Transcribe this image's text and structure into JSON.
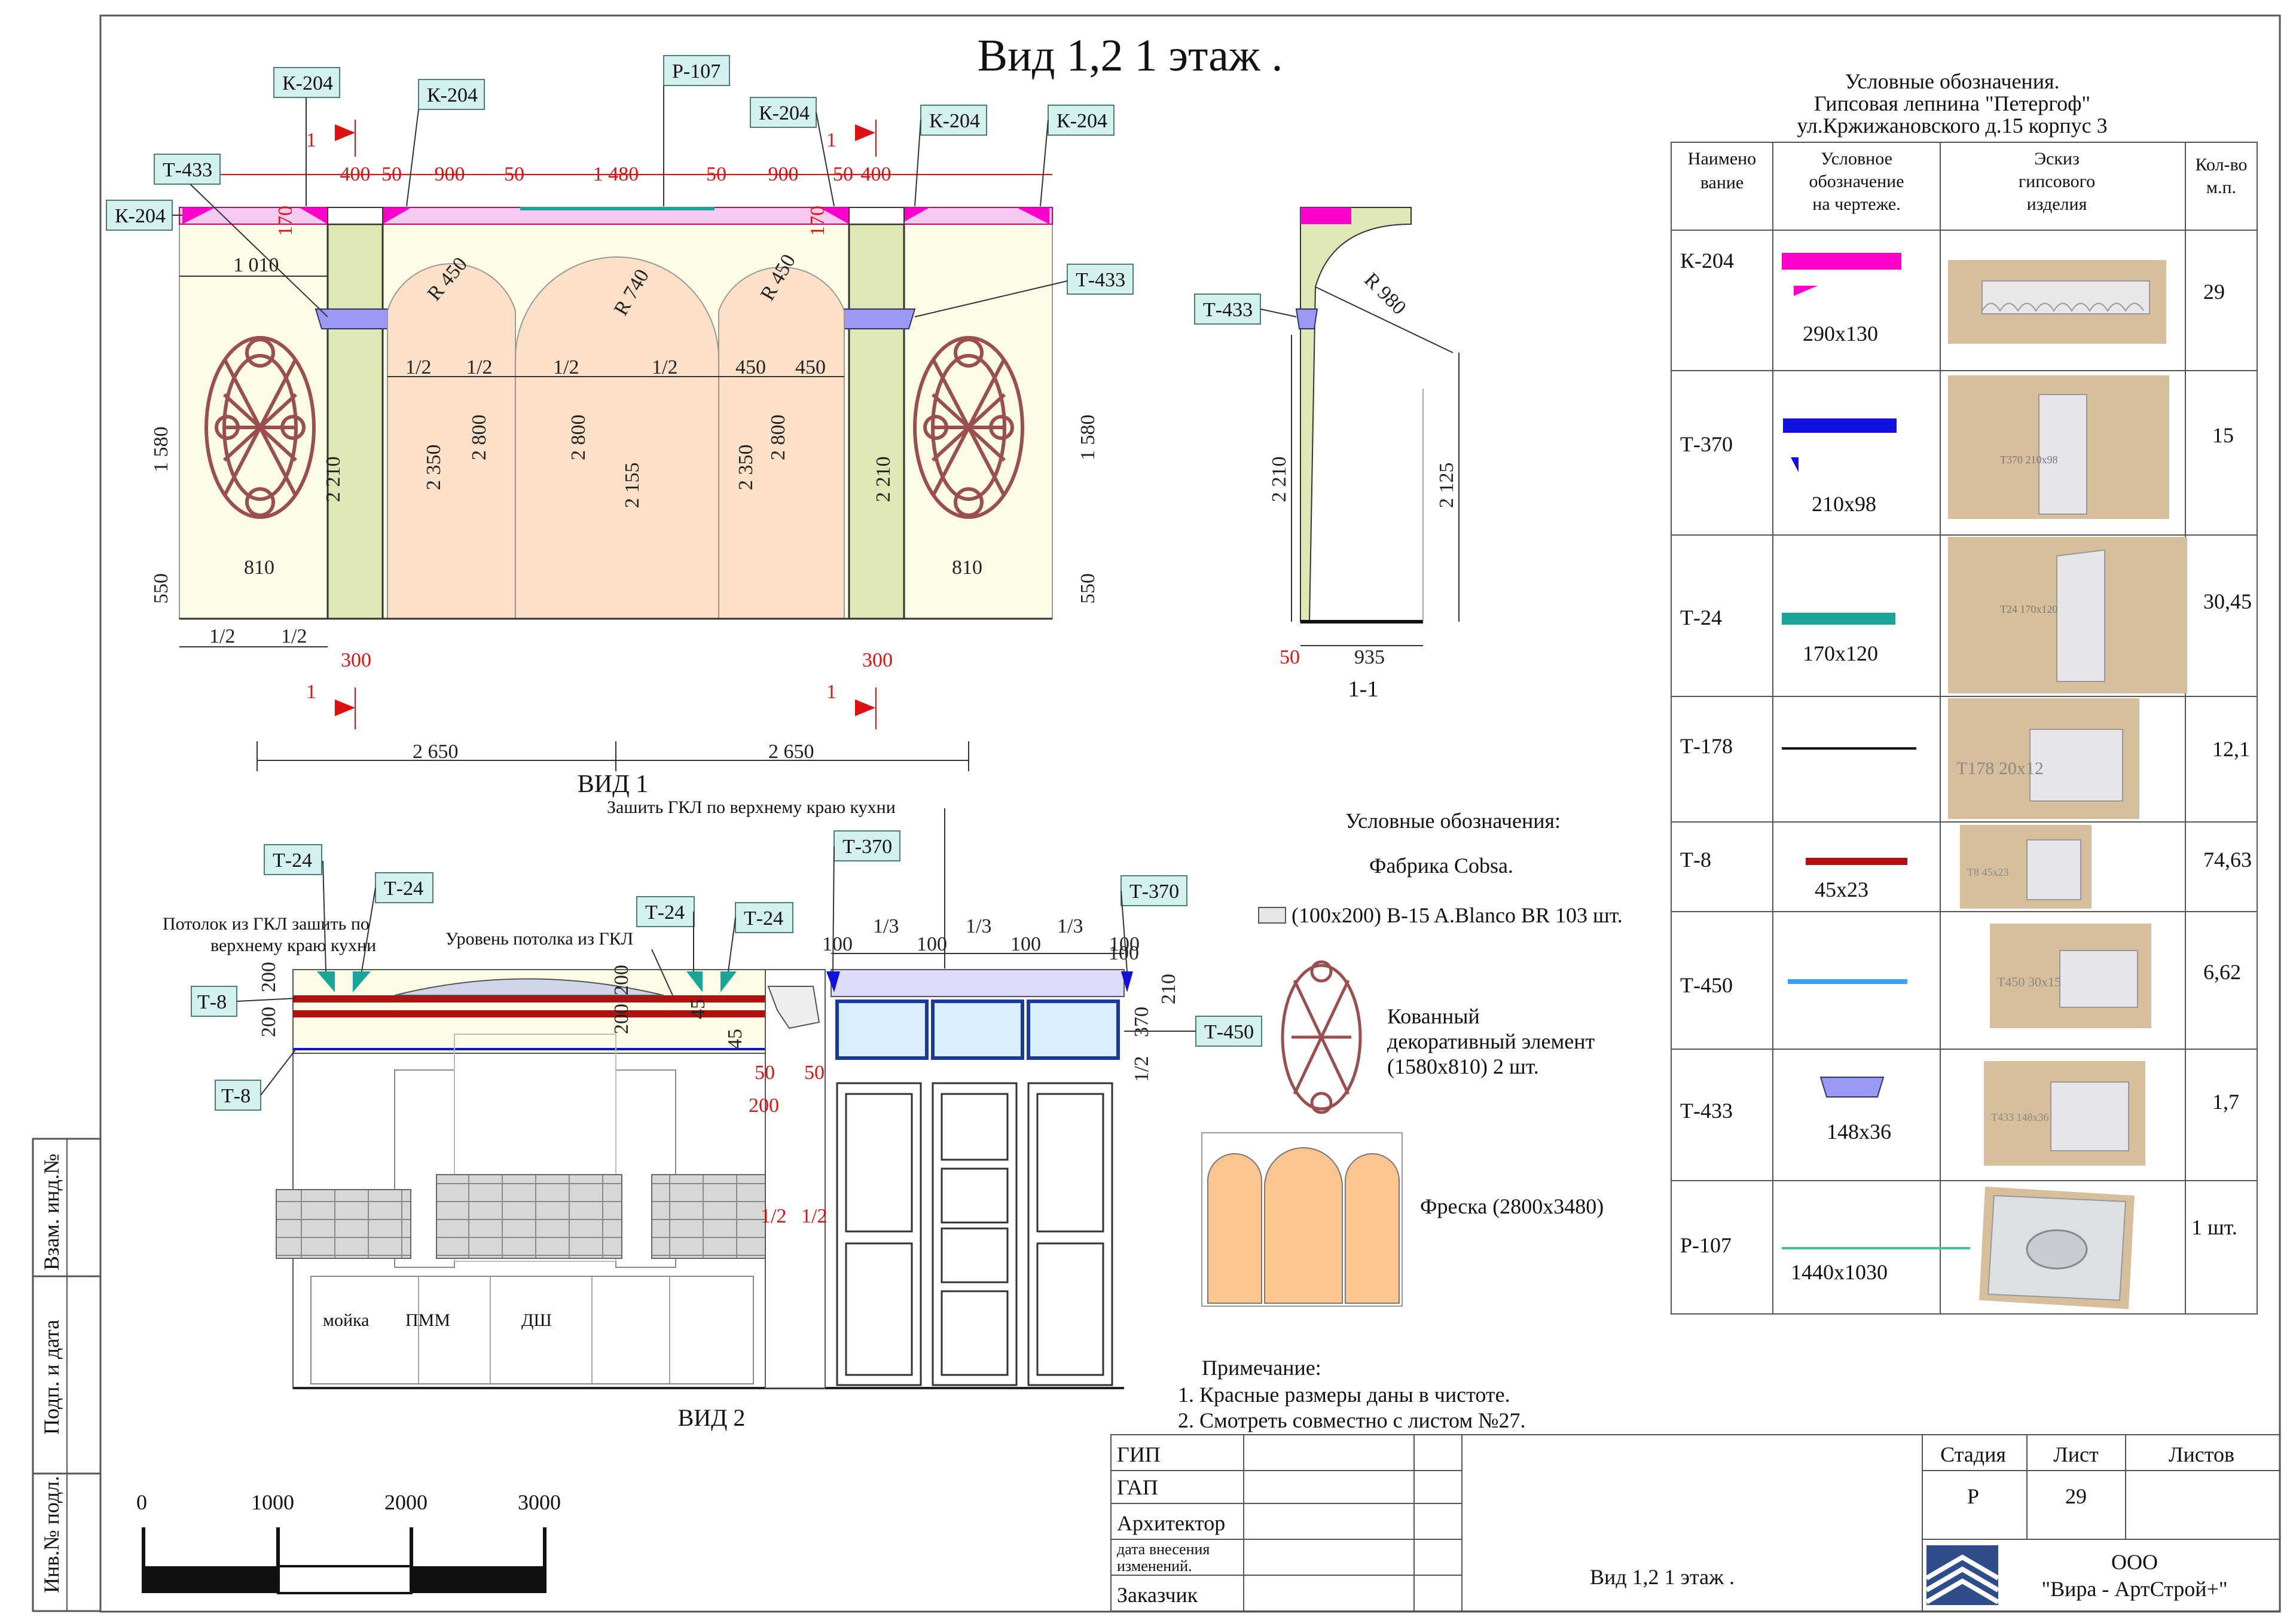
{
  "title": "Вид 1,2  1 этаж .",
  "view1": {
    "caption": "ВИД 1",
    "tags": [
      "К-204",
      "К-204",
      "Р-107",
      "К-204",
      "К-204",
      "К-204",
      "Т-433",
      "Т-433",
      "К-204"
    ],
    "dims_top": [
      "400",
      "50",
      "900",
      "50",
      "1 480",
      "50",
      "900",
      "50",
      "400"
    ],
    "dims_misc": [
      "170",
      "1 010",
      "R 450",
      "R 740",
      "R 450",
      "170",
      "1/2",
      "1/2",
      "1/2",
      "1/2",
      "450",
      "450",
      "1 580",
      "2 210",
      "2 350",
      "2 800",
      "2 800",
      "2 155",
      "2 350",
      "2 800",
      "2 210",
      "1 580",
      "810",
      "810",
      "550",
      "550",
      "1/2",
      "1/2",
      "300",
      "300",
      "2 650",
      "2 650"
    ],
    "section_marks": [
      "1",
      "1",
      "1",
      "1"
    ]
  },
  "section": {
    "caption": "1-1",
    "tag": "Т-433",
    "dims": [
      "R 980",
      "2 210",
      "2 125",
      "50",
      "935"
    ]
  },
  "view2": {
    "caption": "ВИД 2",
    "note_top": "Зашить ГКЛ по верхнему краю кухни",
    "note_ceiling": "Потолок из ГКЛ зашить по верхнему краю кухни",
    "note_level": "Уровень потолка из ГКЛ",
    "tags": [
      "Т-24",
      "Т-24",
      "Т-24",
      "Т-24",
      "Т-370",
      "Т-370",
      "Т-8",
      "Т-8",
      "Т-450"
    ],
    "dims": [
      "200",
      "200",
      "200",
      "200",
      "45",
      "45",
      "100",
      "1/3",
      "100",
      "1/3",
      "100",
      "1/3",
      "100",
      "100",
      "210",
      "370",
      "1/2",
      "50",
      "50",
      "200",
      "1/2",
      "1/2"
    ],
    "cabinet_labels": [
      "мойка",
      "ПММ",
      "ДШ"
    ]
  },
  "legend_mid": {
    "title": "Условные обозначения:",
    "factory": "Фабрика Cobsa.",
    "tile": "(100х200) B-15 A.Blanco BR  103 шт.",
    "forged": "Кованный декоративный элемент (1580х810) 2 шт.",
    "forged_lines": [
      "Кованный",
      "декоративный элемент",
      "(1580х810) 2 шт."
    ],
    "fresco": "Фреска (2800х3480)"
  },
  "notes": {
    "title": "Примечание:",
    "items": [
      "1. Красные размеры даны в чистоте.",
      "2. Смотреть совместно с листом №27."
    ]
  },
  "spec_table": {
    "header_lines": [
      "Условные обозначения.",
      "Гипсовая лепнина \"Петергоф\"",
      "ул.Кржижановского д.15 корпус 3"
    ],
    "columns": [
      [
        "Наимено",
        "вание"
      ],
      [
        "Условное",
        "обозначение",
        "на чертеже."
      ],
      [
        "Эскиз",
        "гипсового",
        "изделия"
      ],
      [
        "Кол-во",
        "м.п."
      ]
    ],
    "rows": [
      {
        "name": "К-204",
        "size": "290х130",
        "qty": "29",
        "color": "#ff00cc",
        "sketch_label": ""
      },
      {
        "name": "Т-370",
        "size": "210х98",
        "qty": "15",
        "color": "#1010e0",
        "sketch_label": "T370 210x98"
      },
      {
        "name": "Т-24",
        "size": "170х120",
        "qty": "30,45",
        "color": "#1aa59a",
        "sketch_label": "T24 170x120"
      },
      {
        "name": "Т-178",
        "size": "",
        "qty": "12,1",
        "color": "#111111",
        "sketch_label": "T178 20x12"
      },
      {
        "name": "Т-8",
        "size": "45х23",
        "qty": "74,63",
        "color": "#b01010",
        "sketch_label": "T8 45x23"
      },
      {
        "name": "Т-450",
        "size": "",
        "qty": "6,62",
        "color": "#3aa0ff",
        "sketch_label": "T450 30x15"
      },
      {
        "name": "Т-433",
        "size": "148х36",
        "qty": "1,7",
        "color": "#9a9af5",
        "sketch_label": "T433 148x36"
      },
      {
        "name": "Р-107",
        "size": "1440х1030",
        "qty": "1 шт.",
        "color": "#40c0a8",
        "sketch_label": ""
      }
    ]
  },
  "scale_bar": {
    "labels": [
      "0",
      "1000",
      "2000",
      "3000"
    ]
  },
  "side_stamp": [
    "Взам. инд.№",
    "Подп. и дата",
    "Инв.№ подл."
  ],
  "title_block": {
    "roles": [
      "ГИП",
      "ГАП",
      "Архитектор",
      "дата  внесения изменений.",
      "Заказчик"
    ],
    "sheet_name": "Вид 1,2  1 этаж .",
    "headers": [
      "Стадия",
      "Лист",
      "Листов"
    ],
    "stage": "Р",
    "sheet": "29",
    "sheets": "",
    "company_lines": [
      "ООО",
      "\"Вира - АртСтрой+\""
    ]
  }
}
